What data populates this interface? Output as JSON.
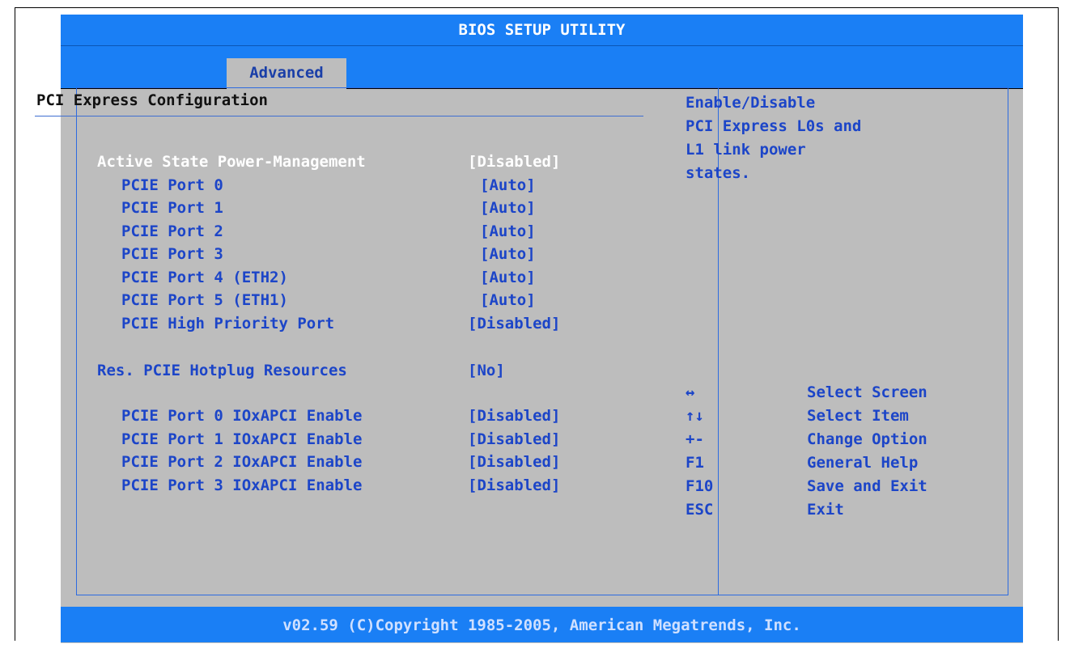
{
  "window": {
    "title": "BIOS SETUP UTILITY"
  },
  "menu": {
    "active_tab": "Advanced"
  },
  "section": {
    "title": "PCI Express Configuration"
  },
  "settings": [
    {
      "label": "Active State Power-Management",
      "value": "[Disabled]",
      "selected": true
    },
    {
      "label": "PCIE Port 0",
      "value": "[Auto]"
    },
    {
      "label": "PCIE Port 1",
      "value": "[Auto]"
    },
    {
      "label": "PCIE Port 2",
      "value": "[Auto]"
    },
    {
      "label": "PCIE Port 3",
      "value": "[Auto]"
    },
    {
      "label": "PCIE Port 4 (ETH2)",
      "value": "[Auto]"
    },
    {
      "label": "PCIE Port 5 (ETH1)",
      "value": "[Auto]"
    },
    {
      "label": "PCIE High Priority Port",
      "value": "[Disabled]"
    },
    {
      "label": "Res. PCIE Hotplug Resources",
      "value": "[No]"
    },
    {
      "label": "PCIE Port 0 IOxAPCI Enable",
      "value": "[Disabled]"
    },
    {
      "label": "PCIE Port 1 IOxAPCI Enable",
      "value": "[Disabled]"
    },
    {
      "label": "PCIE Port 2 IOxAPCI Enable",
      "value": "[Disabled]"
    },
    {
      "label": "PCIE Port 3 IOxAPCI Enable",
      "value": "[Disabled]"
    }
  ],
  "help": {
    "lines": [
      "Enable/Disable",
      "PCI Express L0s and",
      "L1 link power",
      "states."
    ]
  },
  "keys": [
    {
      "key": "↔",
      "desc": "Select Screen",
      "icon": "left-right-arrow-icon"
    },
    {
      "key": "↑↓",
      "desc": "Select Item",
      "icon": "up-down-arrow-icon"
    },
    {
      "key": "+-",
      "desc": "Change Option"
    },
    {
      "key": "F1",
      "desc": "General Help"
    },
    {
      "key": "F10",
      "desc": "Save and Exit"
    },
    {
      "key": "ESC",
      "desc": "Exit"
    }
  ],
  "footer": {
    "text": "v02.59 (C)Copyright 1985-2005, American Megatrends, Inc."
  },
  "colors": {
    "bar_blue": "#1a7ff5",
    "panel_gray": "#bdbdbd",
    "text_blue": "#1c45c8",
    "highlight_white": "#ffffff"
  }
}
